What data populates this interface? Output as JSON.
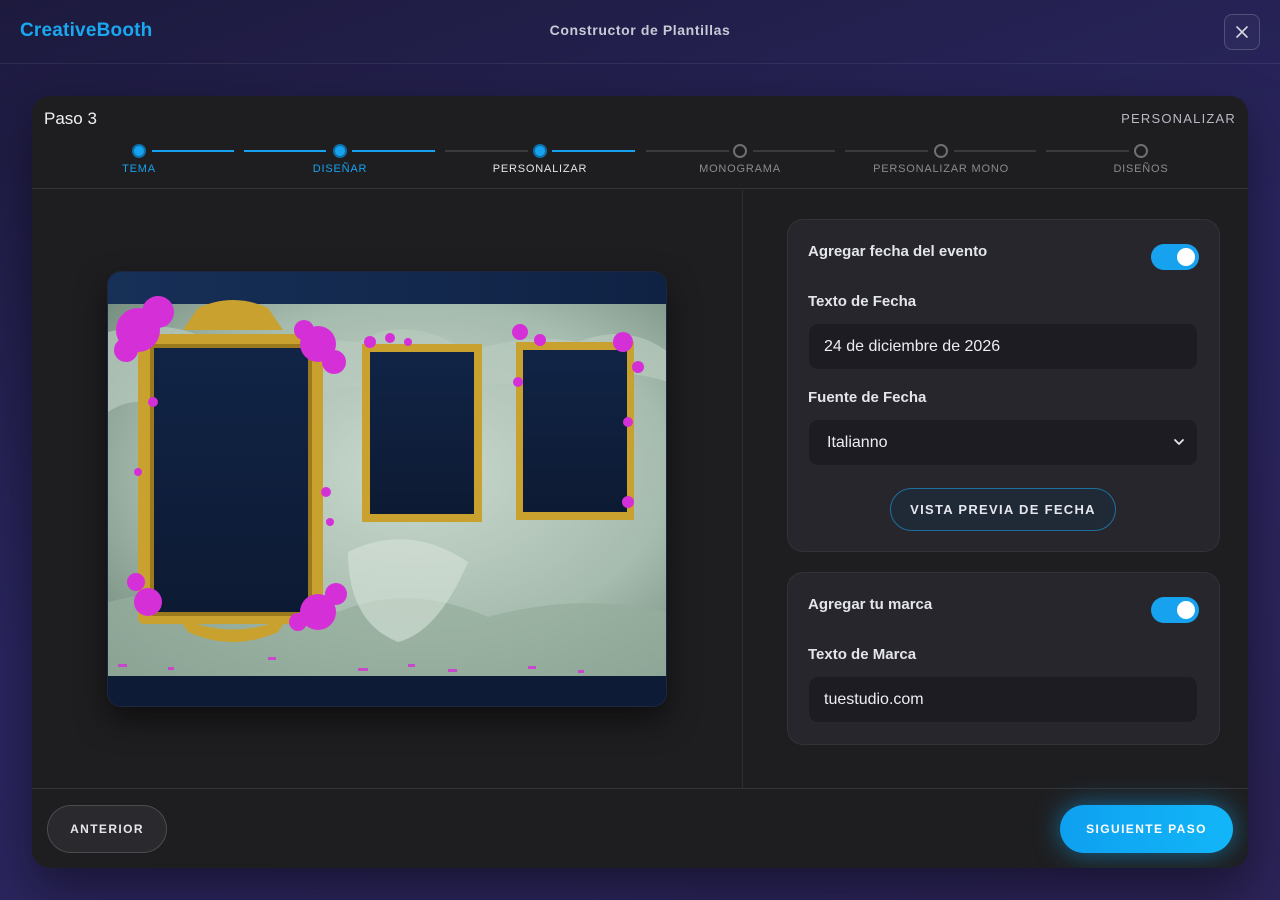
{
  "app": {
    "brand": "CreativeBooth",
    "title": "Constructor de Plantillas"
  },
  "colors": {
    "accent": "#16a2ee",
    "frame_gold": "#c9a12e",
    "flowers": "#d530d8"
  },
  "header": {
    "step_number": "Paso 3",
    "step_name": "PERSONALIZAR"
  },
  "stepper": {
    "current_index": 2,
    "steps": [
      {
        "label": "TEMA",
        "state": "done"
      },
      {
        "label": "DISEÑAR",
        "state": "done"
      },
      {
        "label": "PERSONALIZAR",
        "state": "current"
      },
      {
        "label": "MONOGRAMA",
        "state": "pending"
      },
      {
        "label": "PERSONALIZAR MONO",
        "state": "pending"
      },
      {
        "label": "DISEÑOS",
        "state": "pending"
      }
    ]
  },
  "date_card": {
    "title": "Agregar fecha del evento",
    "enabled": true,
    "text_label": "Texto de Fecha",
    "text_value": "24 de diciembre de 2026",
    "font_label": "Fuente de Fecha",
    "font_value": "Italianno",
    "preview_button": "VISTA PREVIA DE FECHA"
  },
  "brand_card": {
    "title": "Agregar tu marca",
    "enabled": true,
    "text_label": "Texto de Marca",
    "text_value": "tuestudio.com"
  },
  "footer": {
    "prev_label": "ANTERIOR",
    "next_label": "SIGUIENTE PASO"
  },
  "icons": {
    "close": "close-icon",
    "select": "chevron-down-icon"
  }
}
